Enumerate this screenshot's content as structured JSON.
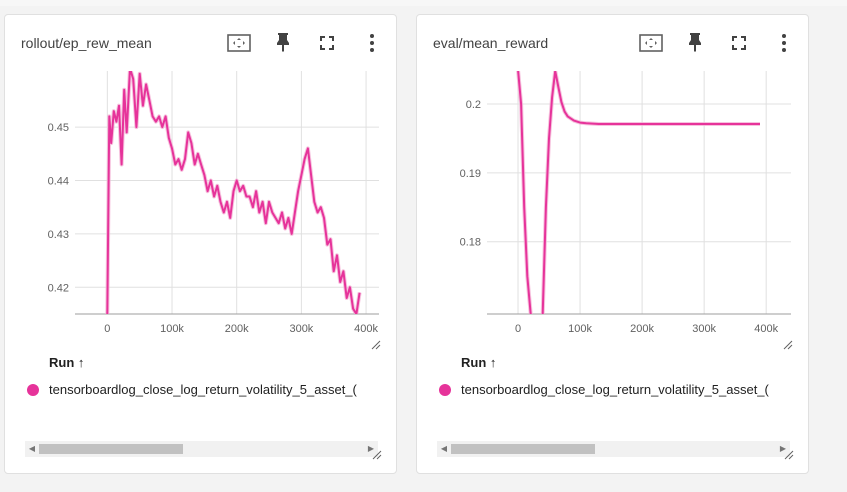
{
  "colors": {
    "series": "#e6339a",
    "series_light": "#f4b3d6",
    "grid": "#e0e0e0",
    "axis_text": "#616161"
  },
  "icons": [
    "fit-domain-icon",
    "pin-icon",
    "fullscreen-icon",
    "more-vert-icon"
  ],
  "cards": [
    {
      "title": "rollout/ep_rew_mean",
      "run_header": "Run ↑",
      "run_name": "tensorboardlog_close_log_return_volatility_5_asset_("
    },
    {
      "title": "eval/mean_reward",
      "run_header": "Run ↑",
      "run_name": "tensorboardlog_close_log_return_volatility_5_asset_("
    }
  ],
  "chart_data": [
    {
      "type": "line",
      "title": "rollout/ep_rew_mean",
      "xticks": [
        "0",
        "100k",
        "200k",
        "300k",
        "400k"
      ],
      "yticks": [
        "0.42",
        "0.43",
        "0.44",
        "0.45"
      ],
      "xlim": [
        -50000,
        420000
      ],
      "ylim": [
        0.415,
        0.4605
      ],
      "grid": true,
      "series": [
        {
          "name": "tensorboardlog_close_log_return_volatility_5_asset_(",
          "x": [
            0,
            3000,
            6000,
            10000,
            14000,
            18000,
            22000,
            26000,
            30000,
            35000,
            40000,
            45000,
            50000,
            55000,
            60000,
            65000,
            70000,
            75000,
            80000,
            85000,
            90000,
            95000,
            100000,
            105000,
            110000,
            115000,
            120000,
            125000,
            130000,
            135000,
            140000,
            145000,
            150000,
            155000,
            160000,
            165000,
            170000,
            175000,
            180000,
            185000,
            190000,
            195000,
            200000,
            205000,
            210000,
            215000,
            220000,
            225000,
            230000,
            235000,
            240000,
            245000,
            250000,
            255000,
            260000,
            265000,
            270000,
            275000,
            280000,
            285000,
            290000,
            295000,
            300000,
            305000,
            310000,
            315000,
            320000,
            325000,
            330000,
            335000,
            340000,
            345000,
            350000,
            355000,
            360000,
            365000,
            370000,
            375000,
            380000,
            385000,
            390000
          ],
          "y": [
            0.415,
            0.452,
            0.447,
            0.453,
            0.451,
            0.454,
            0.443,
            0.457,
            0.449,
            0.461,
            0.459,
            0.45,
            0.46,
            0.454,
            0.458,
            0.455,
            0.452,
            0.451,
            0.452,
            0.45,
            0.452,
            0.448,
            0.446,
            0.443,
            0.444,
            0.442,
            0.444,
            0.449,
            0.447,
            0.443,
            0.445,
            0.443,
            0.441,
            0.438,
            0.44,
            0.437,
            0.439,
            0.436,
            0.434,
            0.436,
            0.433,
            0.438,
            0.44,
            0.438,
            0.439,
            0.437,
            0.437,
            0.435,
            0.438,
            0.434,
            0.436,
            0.432,
            0.436,
            0.434,
            0.433,
            0.432,
            0.434,
            0.431,
            0.433,
            0.43,
            0.434,
            0.438,
            0.441,
            0.444,
            0.446,
            0.441,
            0.436,
            0.434,
            0.435,
            0.433,
            0.428,
            0.429,
            0.423,
            0.426,
            0.421,
            0.423,
            0.418,
            0.42,
            0.416,
            0.415,
            0.419
          ]
        }
      ]
    },
    {
      "type": "line",
      "title": "eval/mean_reward",
      "xticks": [
        "0",
        "100k",
        "200k",
        "300k",
        "400k"
      ],
      "yticks": [
        "0.18",
        "0.19",
        "0.2"
      ],
      "xlim": [
        -50000,
        440000
      ],
      "ylim": [
        0.1695,
        0.2048
      ],
      "grid": true,
      "series": [
        {
          "name": "tensorboardlog_close_log_return_volatility_5_asset_(",
          "x": [
            0,
            5000,
            10000,
            15000,
            20000,
            25000,
            30000,
            35000,
            40000,
            45000,
            50000,
            55000,
            60000,
            65000,
            70000,
            75000,
            80000,
            90000,
            100000,
            110000,
            130000,
            160000,
            200000,
            250000,
            300000,
            350000,
            390000
          ],
          "y": [
            0.205,
            0.2,
            0.185,
            0.175,
            0.17,
            0.165,
            0.16,
            0.155,
            0.17,
            0.185,
            0.195,
            0.201,
            0.2048,
            0.2025,
            0.2003,
            0.1989,
            0.1982,
            0.1976,
            0.1973,
            0.1972,
            0.1971,
            0.1971,
            0.1971,
            0.1971,
            0.1971,
            0.1971,
            0.1971
          ]
        }
      ]
    }
  ]
}
